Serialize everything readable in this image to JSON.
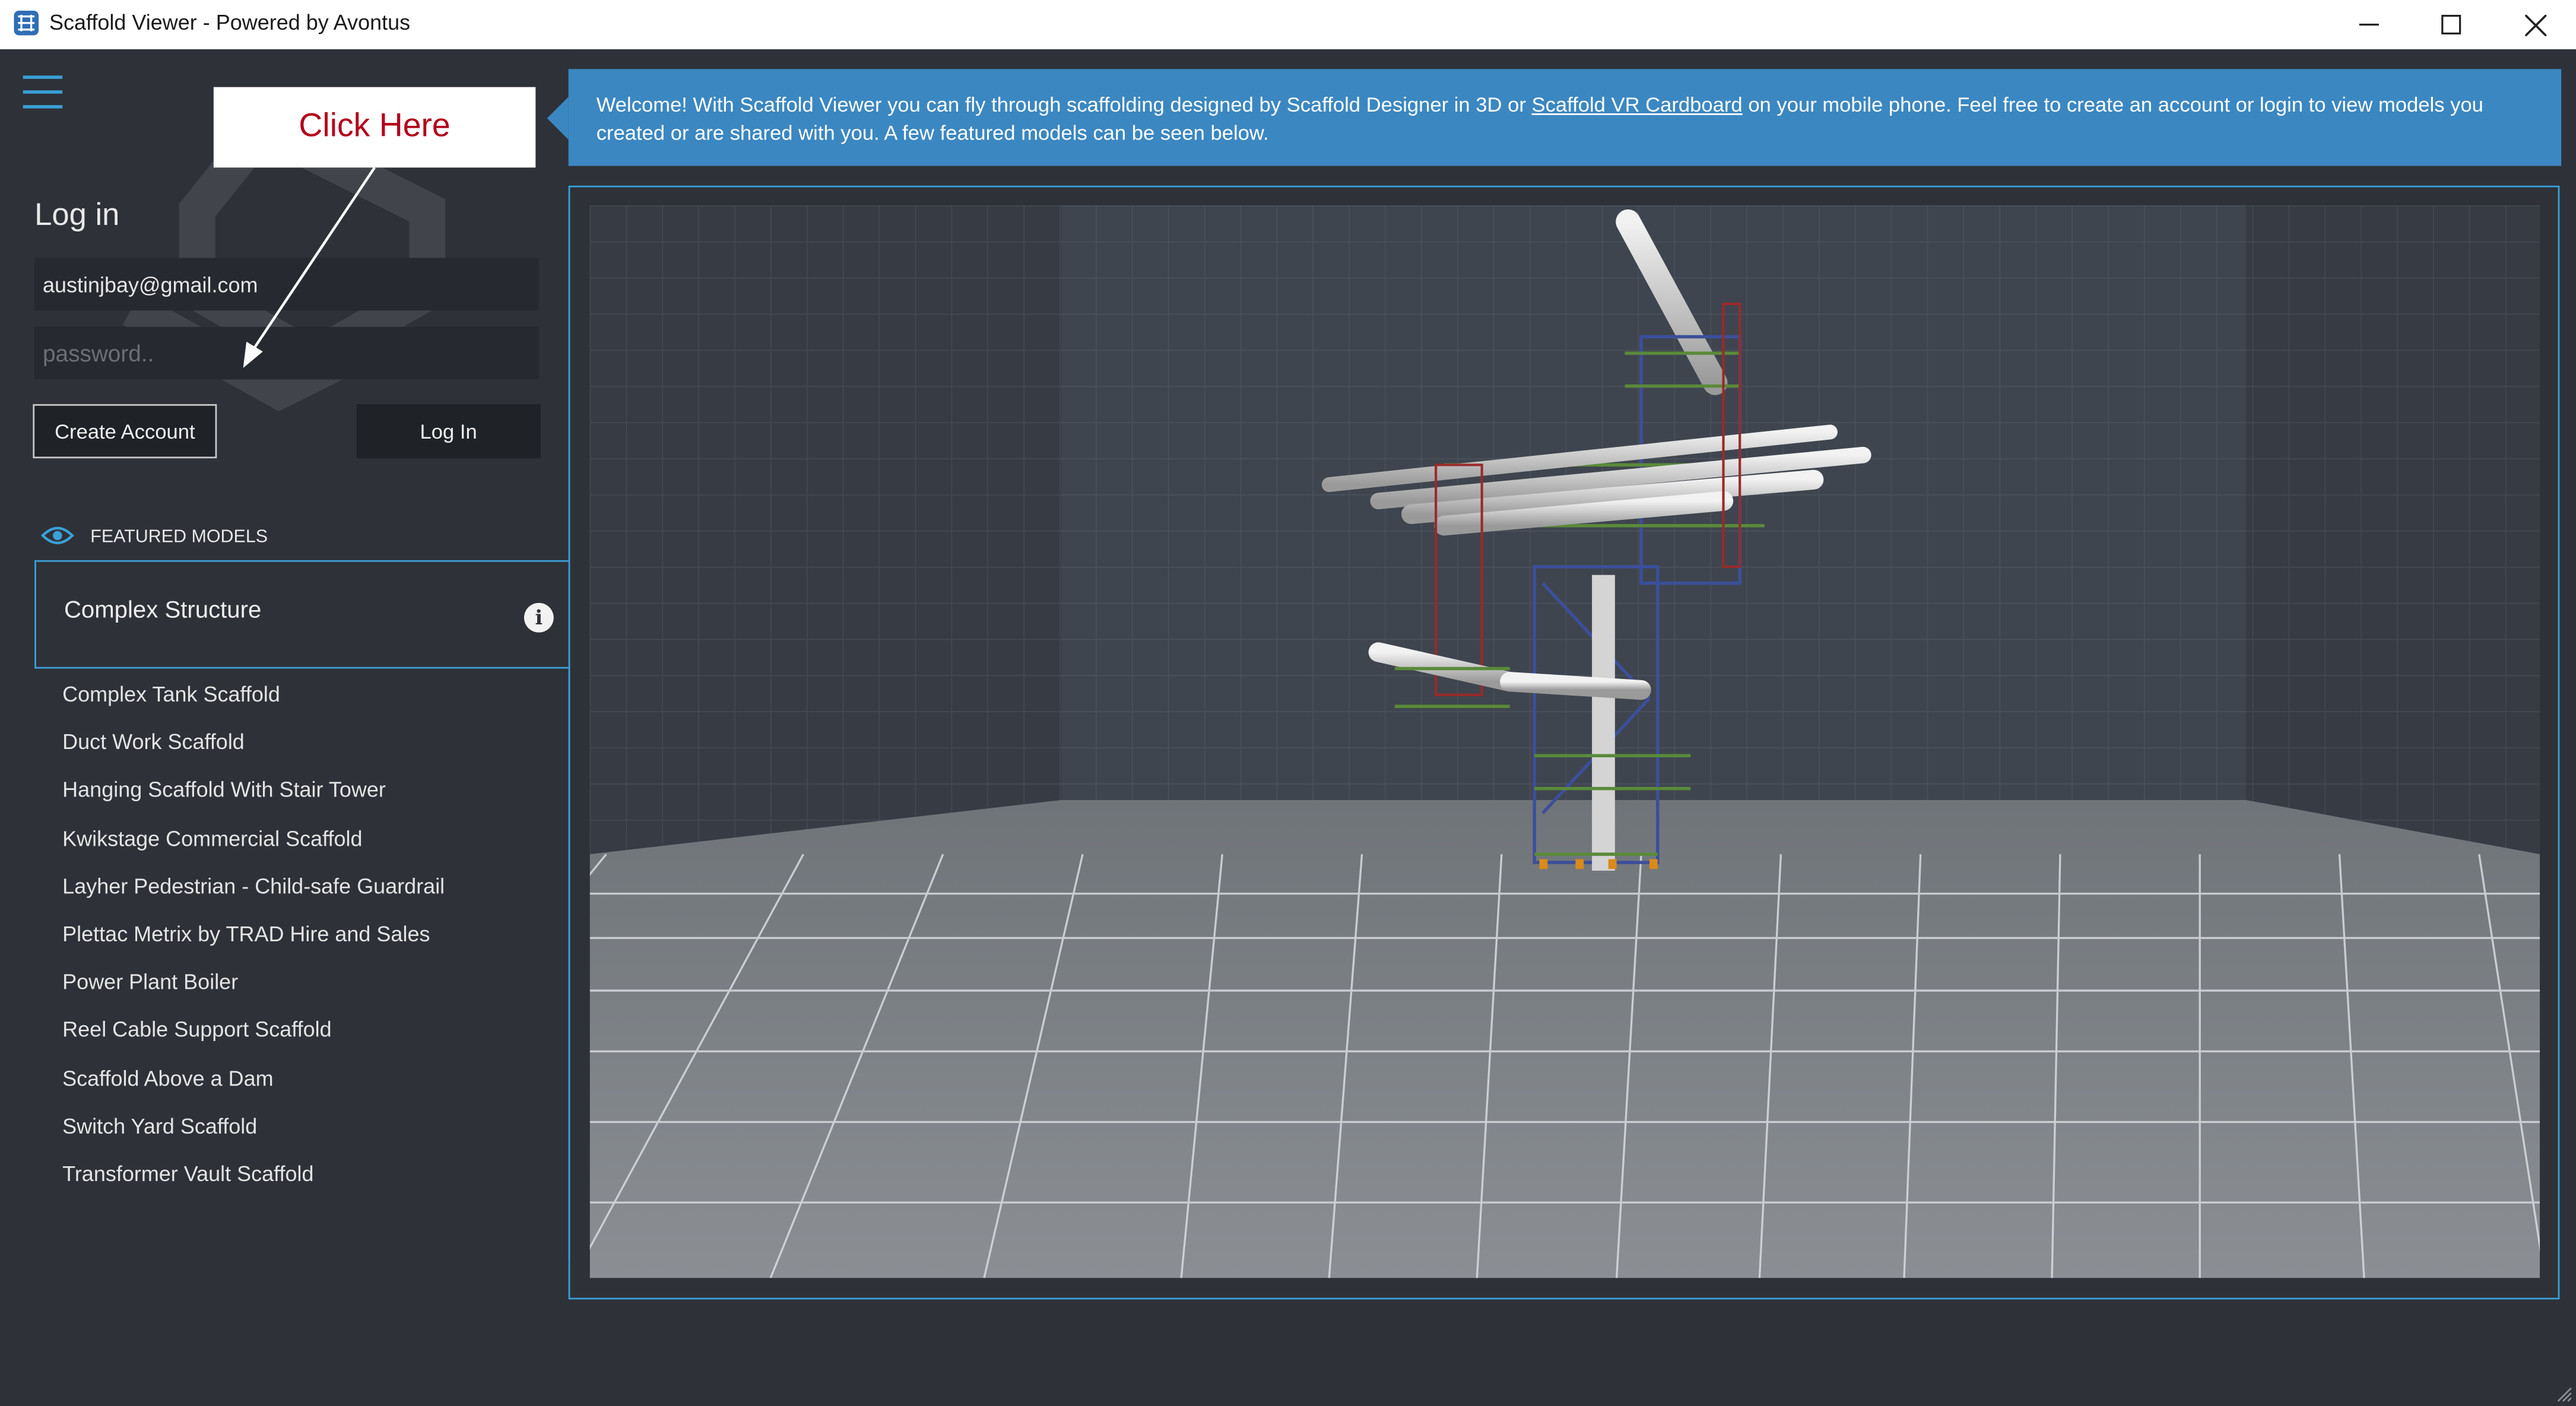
{
  "window": {
    "title": "Scaffold Viewer - Powered by Avontus",
    "controls": [
      "minimize-icon",
      "maximize-icon",
      "close-icon"
    ]
  },
  "sidebar": {
    "menu_icon": "hamburger-icon",
    "login": {
      "heading": "Log in",
      "email_value": "austinjbay@gmail.com",
      "password_placeholder": "password..",
      "create_account_label": "Create Account",
      "login_label": "Log In"
    },
    "callout": {
      "text": "Click Here"
    },
    "featured": {
      "header": "FEATURED MODELS",
      "icon": "eye-icon",
      "selected": "Complex Structure",
      "items": [
        "Complex Tank Scaffold",
        "Duct Work Scaffold",
        "Hanging Scaffold With Stair Tower",
        "Kwikstage Commercial Scaffold",
        "Layher Pedestrian - Child-safe Guardrail",
        "Plettac Metrix by TRAD Hire and Sales",
        "Power Plant Boiler",
        "Reel Cable Support Scaffold",
        "Scaffold Above a Dam",
        "Switch Yard Scaffold",
        "Transformer Vault Scaffold"
      ]
    }
  },
  "banner": {
    "text_before": "Welcome! With Scaffold Viewer you can fly through scaffolding designed by Scaffold Designer in 3D or ",
    "link": "Scaffold VR Cardboard",
    "text_after": " on your mobile phone. Feel free to create an account or login to view models you created or are shared with you. A few featured models can be seen below."
  },
  "colors": {
    "accent": "#3aa0d8",
    "banner": "#3b87c1",
    "background": "#2e3138",
    "callout_text": "#b3001b"
  }
}
